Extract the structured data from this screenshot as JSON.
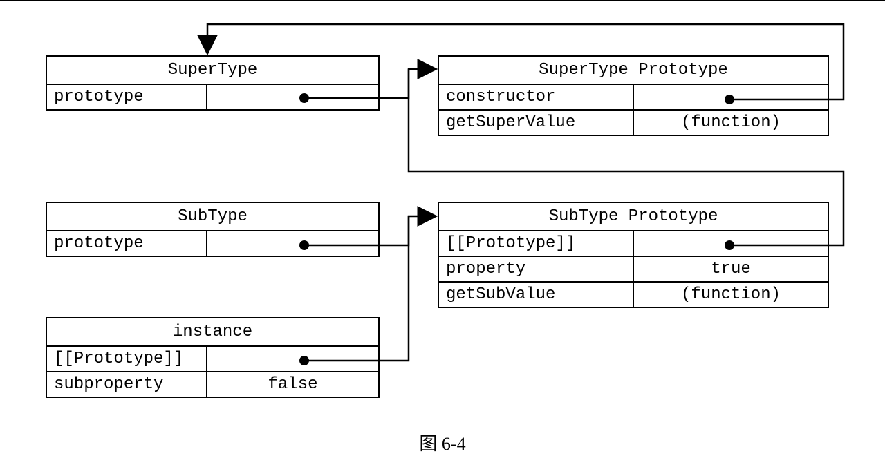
{
  "boxes": {
    "supertype": {
      "title": "SuperType",
      "rows": [
        {
          "key": "prototype",
          "value": ""
        }
      ]
    },
    "supertype_proto": {
      "title": "SuperType Prototype",
      "rows": [
        {
          "key": "constructor",
          "value": ""
        },
        {
          "key": "getSuperValue",
          "value": "(function)"
        }
      ]
    },
    "subtype": {
      "title": "SubType",
      "rows": [
        {
          "key": "prototype",
          "value": ""
        }
      ]
    },
    "subtype_proto": {
      "title": "SubType Prototype",
      "rows": [
        {
          "key": "[[Prototype]]",
          "value": ""
        },
        {
          "key": "property",
          "value": "true"
        },
        {
          "key": "getSubValue",
          "value": "(function)"
        }
      ]
    },
    "instance": {
      "title": "instance",
      "rows": [
        {
          "key": "[[Prototype]]",
          "value": ""
        },
        {
          "key": "subproperty",
          "value": "false"
        }
      ]
    }
  },
  "caption": "图  6-4"
}
